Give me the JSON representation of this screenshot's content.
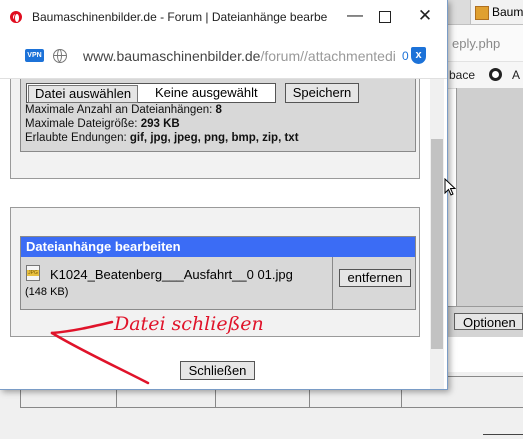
{
  "background": {
    "tab_title": "Baumas",
    "address_fragment": "eply.php",
    "bookmark_1": "bace",
    "bookmark_2": "A",
    "optionen_label": "Optionen"
  },
  "popup": {
    "title": "Baumaschinenbilder.de - Forum | Dateianhänge bearbe",
    "url_host": "www.baumaschinenbilder.de",
    "url_path": "/forum//attachmentedit.p",
    "vpn_label": "VPN",
    "badge_count": "0",
    "shield_label": "x",
    "upload": {
      "choose_label": "Datei auswählen",
      "no_file_label": "Keine ausgewählt",
      "save_label": "Speichern",
      "max_count_label": "Maximale Anzahl an Dateianhängen:",
      "max_count_value": "8",
      "max_size_label": "Maximale Dateigröße:",
      "max_size_value": "293 KB",
      "extensions_label": "Erlaubte Endungen:",
      "extensions_value": "gif, jpg, jpeg, png, bmp, zip, txt"
    },
    "attachments": {
      "header": "Dateianhänge bearbeiten",
      "items": [
        {
          "file_name": "K1024_Beatenberg___Ausfahrt__0 01.jpg",
          "file_size": "(148 KB)",
          "remove_label": "entfernen"
        }
      ]
    },
    "close_label": "Schließen"
  },
  "annotation": {
    "text": "Datei schließen",
    "color": "#e0132a"
  },
  "colors": {
    "header_blue": "#3b6cf5",
    "opera_red": "#e00d1f",
    "vpn_blue": "#1c72d8"
  }
}
